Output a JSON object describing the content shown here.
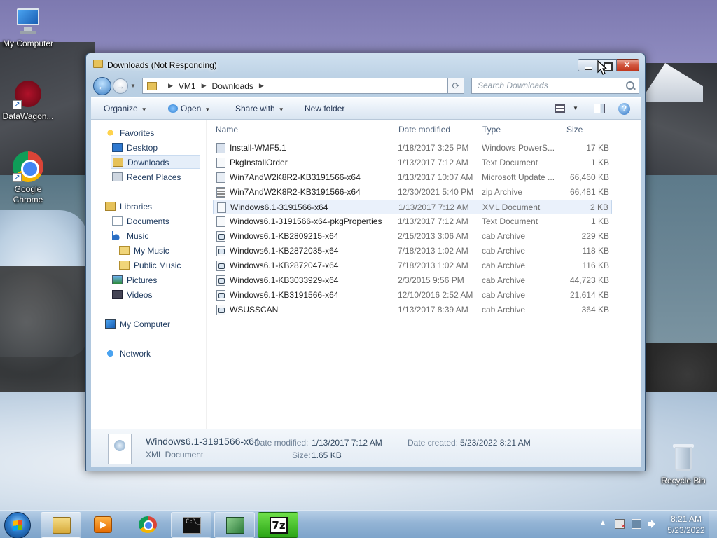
{
  "desktop": {
    "icons": [
      {
        "label": "My Computer",
        "icon": "computer-icon"
      },
      {
        "label": "DataWagon...",
        "icon": "datawagon-icon"
      },
      {
        "label": "Google Chrome",
        "icon": "chrome-icon"
      },
      {
        "label": "Recycle Bin",
        "icon": "recycle-bin-icon"
      }
    ]
  },
  "window": {
    "title": "Downloads (Not Responding)",
    "breadcrumb": [
      "VM1",
      "Downloads"
    ],
    "search_placeholder": "Search Downloads",
    "toolbar": {
      "organize": "Organize",
      "open": "Open",
      "share_with": "Share with",
      "new_folder": "New folder"
    },
    "nav": {
      "favorites": "Favorites",
      "desktop": "Desktop",
      "downloads": "Downloads",
      "recent_places": "Recent Places",
      "libraries": "Libraries",
      "documents": "Documents",
      "music": "Music",
      "my_music": "My Music",
      "public_music": "Public Music",
      "pictures": "Pictures",
      "videos": "Videos",
      "my_computer": "My Computer",
      "network": "Network"
    },
    "columns": {
      "name": "Name",
      "date_modified": "Date modified",
      "type": "Type",
      "size": "Size"
    },
    "files": [
      {
        "name": "Install-WMF5.1",
        "date": "1/18/2017 3:25 PM",
        "type": "Windows PowerS...",
        "size": "17 KB",
        "icon": "powershell-file-icon"
      },
      {
        "name": "PkgInstallOrder",
        "date": "1/13/2017 7:12 AM",
        "type": "Text Document",
        "size": "1 KB",
        "icon": "text-file-icon"
      },
      {
        "name": "Win7AndW2K8R2-KB3191566-x64",
        "date": "1/13/2017 10:07 AM",
        "type": "Microsoft Update ...",
        "size": "66,460 KB",
        "icon": "msu-file-icon"
      },
      {
        "name": "Win7AndW2K8R2-KB3191566-x64",
        "date": "12/30/2021 5:40 PM",
        "type": "zip Archive",
        "size": "66,481 KB",
        "icon": "zip-file-icon"
      },
      {
        "name": "Windows6.1-3191566-x64",
        "date": "1/13/2017 7:12 AM",
        "type": "XML Document",
        "size": "2 KB",
        "icon": "xml-file-icon"
      },
      {
        "name": "Windows6.1-3191566-x64-pkgProperties",
        "date": "1/13/2017 7:12 AM",
        "type": "Text Document",
        "size": "1 KB",
        "icon": "text-file-icon"
      },
      {
        "name": "Windows6.1-KB2809215-x64",
        "date": "2/15/2013 3:06 AM",
        "type": "cab Archive",
        "size": "229 KB",
        "icon": "cab-file-icon"
      },
      {
        "name": "Windows6.1-KB2872035-x64",
        "date": "7/18/2013 1:02 AM",
        "type": "cab Archive",
        "size": "118 KB",
        "icon": "cab-file-icon"
      },
      {
        "name": "Windows6.1-KB2872047-x64",
        "date": "7/18/2013 1:02 AM",
        "type": "cab Archive",
        "size": "116 KB",
        "icon": "cab-file-icon"
      },
      {
        "name": "Windows6.1-KB3033929-x64",
        "date": "2/3/2015 9:56 PM",
        "type": "cab Archive",
        "size": "44,723 KB",
        "icon": "cab-file-icon"
      },
      {
        "name": "Windows6.1-KB3191566-x64",
        "date": "12/10/2016 2:52 AM",
        "type": "cab Archive",
        "size": "21,614 KB",
        "icon": "cab-file-icon"
      },
      {
        "name": "WSUSSCAN",
        "date": "1/13/2017 8:39 AM",
        "type": "cab Archive",
        "size": "364 KB",
        "icon": "cab-file-icon"
      }
    ],
    "selected_row": 4,
    "details": {
      "name": "Windows6.1-3191566-x64",
      "type": "XML Document",
      "date_modified_label": "Date modified:",
      "date_modified": "1/13/2017 7:12 AM",
      "date_created_label": "Date created:",
      "date_created": "5/23/2022 8:21 AM",
      "size_label": "Size:",
      "size": "1.65 KB"
    }
  },
  "taskbar": {
    "apps": [
      "explorer",
      "media-player",
      "chrome",
      "cmd",
      "vm-manager",
      "7zip"
    ],
    "cmd_text": "C:\\_",
    "sevenzip_text": "7z",
    "clock_time": "8:21 AM",
    "clock_date": "5/23/2022"
  }
}
